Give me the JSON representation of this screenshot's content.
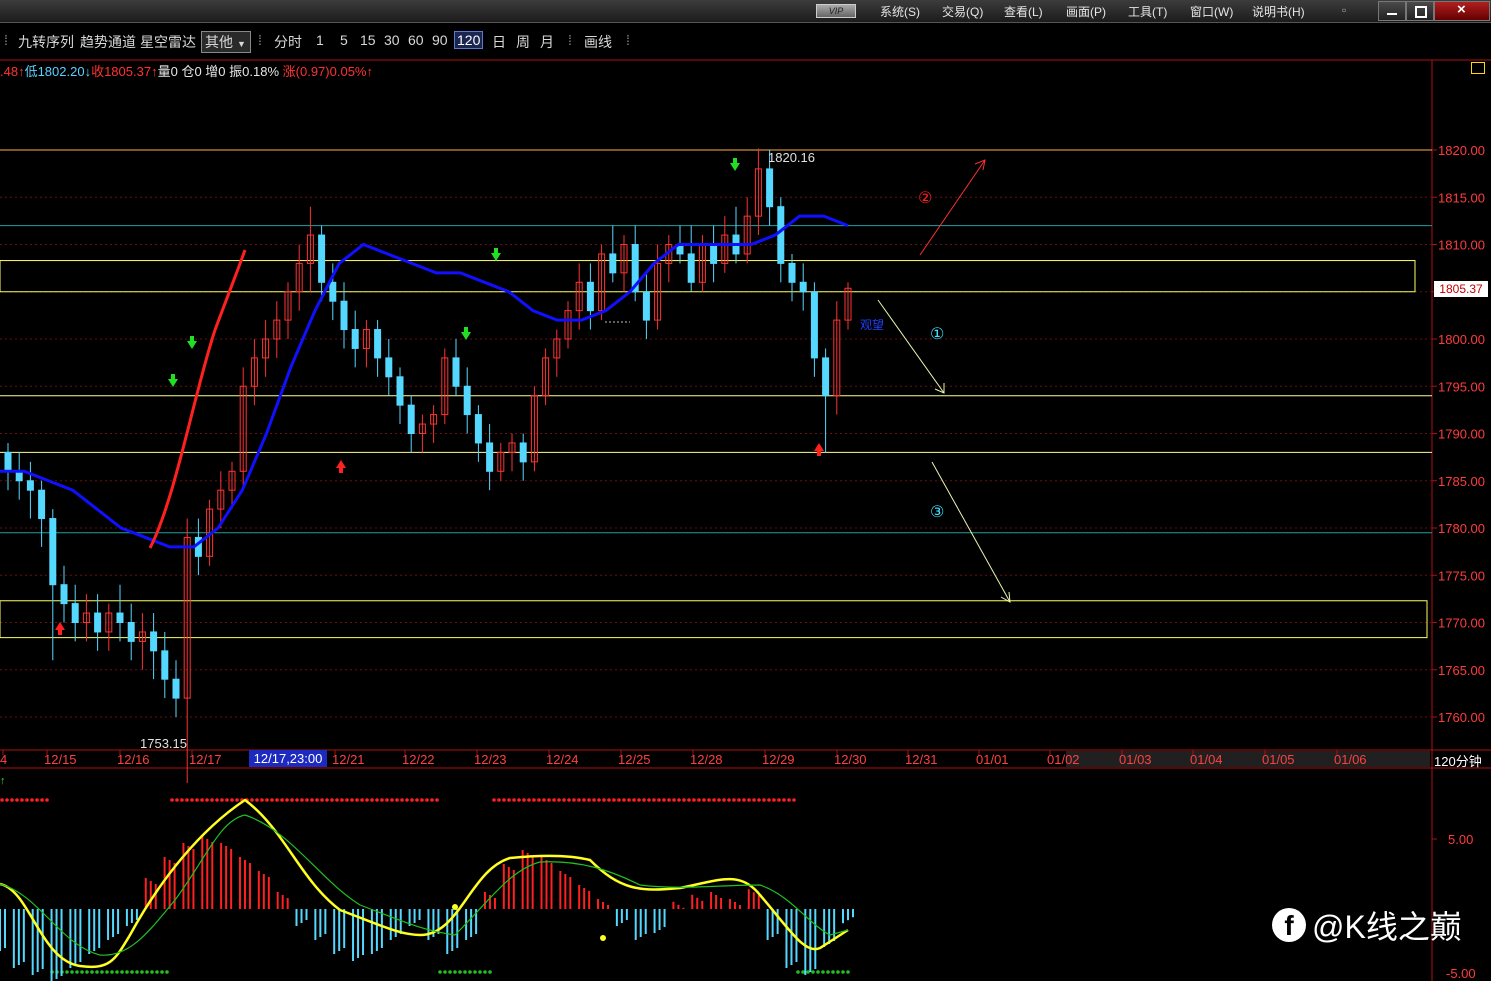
{
  "window": {
    "vip": "VIP",
    "menus": [
      "系统(S)",
      "交易(Q)",
      "查看(L)",
      "画面(P)",
      "工具(T)",
      "窗口(W)",
      "说明书(H)"
    ]
  },
  "toolbar": {
    "items": [
      "九转序列",
      "趋势通道",
      "星空雷达"
    ],
    "dropdown": "其他",
    "periods": [
      "分时",
      "1",
      "5",
      "15",
      "30",
      "60",
      "90",
      "120",
      "日",
      "周",
      "月"
    ],
    "selected_period": "120",
    "draw": "画线"
  },
  "quote": {
    "open_frag": ".48↑",
    "low": "低1802.20↓",
    "close": "收1805.37↑",
    "volume": "量0",
    "oi": "仓0",
    "incr": "增0",
    "amp": "振0.18%",
    "chg": "涨(0.97)0.05%↑"
  },
  "price_axis": {
    "ticks": [
      "1820.00",
      "1815.00",
      "1810.00",
      "1805.00",
      "1800.00",
      "1795.00",
      "1790.00",
      "1785.00",
      "1780.00",
      "1775.00",
      "1770.00",
      "1765.00",
      "1760.00"
    ],
    "last_price": "1805.37"
  },
  "time_axis": {
    "labels": [
      "4",
      "12/15",
      "12/16",
      "12/17",
      "12/21",
      "12/22",
      "12/23",
      "12/24",
      "12/25",
      "12/28",
      "12/29",
      "12/30",
      "12/31",
      "01/01",
      "01/02",
      "01/03",
      "01/04",
      "01/05",
      "01/06"
    ],
    "hover": "12/17,23:00",
    "period": "120分钟"
  },
  "annotations": {
    "high": "1820.16",
    "low": "1753.15",
    "watch": "观望",
    "path_labels": [
      "②",
      "①",
      "③"
    ]
  },
  "indicator_axis": {
    "ticks": [
      "5.00",
      "-5.00"
    ]
  },
  "watermark": {
    "icon": "f",
    "text": "@K线之巅"
  },
  "colors": {
    "up": "#ff3232",
    "down": "#54d8ff",
    "ma": "#1010ff",
    "trend": "#ff2020",
    "level": "#ffff60",
    "axis": "#b01010"
  },
  "chart_data": {
    "type": "candlestick",
    "price_ylim": [
      1757,
      1823
    ],
    "marked_high": 1820.16,
    "marked_low": 1753.15,
    "last_close": 1805.37,
    "levels": [
      1820.0,
      1812.0,
      1808.0,
      1805.0,
      1794.0,
      1788.0,
      1779.0,
      1772.0,
      1768.0
    ],
    "candles": [
      [
        1788,
        1789,
        1784,
        1786
      ],
      [
        1786,
        1788,
        1783,
        1785
      ],
      [
        1785,
        1787,
        1781,
        1784
      ],
      [
        1784,
        1785,
        1778,
        1781
      ],
      [
        1781,
        1782,
        1766,
        1774
      ],
      [
        1774,
        1776,
        1770,
        1772
      ],
      [
        1772,
        1774,
        1768,
        1770
      ],
      [
        1770,
        1773,
        1768,
        1771
      ],
      [
        1771,
        1773,
        1767,
        1769
      ],
      [
        1769,
        1772,
        1767,
        1771
      ],
      [
        1771,
        1774,
        1768,
        1770
      ],
      [
        1770,
        1772,
        1766,
        1768
      ],
      [
        1768,
        1771,
        1765,
        1769
      ],
      [
        1769,
        1771,
        1764,
        1767
      ],
      [
        1767,
        1769,
        1762,
        1764
      ],
      [
        1764,
        1766,
        1760,
        1762
      ],
      [
        1762,
        1781,
        1753,
        1779
      ],
      [
        1779,
        1781,
        1775,
        1777
      ],
      [
        1777,
        1783,
        1776,
        1782
      ],
      [
        1782,
        1786,
        1780,
        1784
      ],
      [
        1784,
        1787,
        1782,
        1786
      ],
      [
        1786,
        1797,
        1784,
        1795
      ],
      [
        1795,
        1800,
        1793,
        1798
      ],
      [
        1798,
        1802,
        1796,
        1800
      ],
      [
        1800,
        1804,
        1798,
        1802
      ],
      [
        1802,
        1806,
        1800,
        1805
      ],
      [
        1805,
        1810,
        1803,
        1808
      ],
      [
        1808,
        1814,
        1805,
        1811
      ],
      [
        1811,
        1812,
        1804,
        1806
      ],
      [
        1806,
        1808,
        1802,
        1804
      ],
      [
        1804,
        1806,
        1799,
        1801
      ],
      [
        1801,
        1803,
        1797,
        1799
      ],
      [
        1799,
        1802,
        1797,
        1801
      ],
      [
        1801,
        1802,
        1796,
        1798
      ],
      [
        1798,
        1800,
        1794,
        1796
      ],
      [
        1796,
        1797,
        1791,
        1793
      ],
      [
        1793,
        1794,
        1788,
        1790
      ],
      [
        1790,
        1792,
        1788,
        1791
      ],
      [
        1791,
        1793,
        1789,
        1792
      ],
      [
        1792,
        1799,
        1791,
        1798
      ],
      [
        1798,
        1800,
        1794,
        1795
      ],
      [
        1795,
        1797,
        1790,
        1792
      ],
      [
        1792,
        1793,
        1787,
        1789
      ],
      [
        1789,
        1791,
        1784,
        1786
      ],
      [
        1786,
        1789,
        1785,
        1788
      ],
      [
        1788,
        1790,
        1786,
        1789
      ],
      [
        1789,
        1790,
        1785,
        1787
      ],
      [
        1787,
        1795,
        1786,
        1794
      ],
      [
        1794,
        1799,
        1793,
        1798
      ],
      [
        1798,
        1801,
        1796,
        1800
      ],
      [
        1800,
        1804,
        1799,
        1803
      ],
      [
        1803,
        1808,
        1801,
        1806
      ],
      [
        1806,
        1808,
        1801,
        1803
      ],
      [
        1803,
        1810,
        1802,
        1809
      ],
      [
        1809,
        1812,
        1806,
        1807
      ],
      [
        1807,
        1811,
        1805,
        1810
      ],
      [
        1810,
        1812,
        1804,
        1805
      ],
      [
        1805,
        1807,
        1800,
        1802
      ],
      [
        1802,
        1810,
        1801,
        1808
      ],
      [
        1808,
        1811,
        1806,
        1810
      ],
      [
        1810,
        1812,
        1808,
        1809
      ],
      [
        1809,
        1812,
        1805,
        1806
      ],
      [
        1806,
        1811,
        1805,
        1810
      ],
      [
        1810,
        1812,
        1806,
        1808
      ],
      [
        1808,
        1813,
        1807,
        1811
      ],
      [
        1811,
        1814,
        1808,
        1809
      ],
      [
        1809,
        1815,
        1808,
        1813
      ],
      [
        1813,
        1820.16,
        1811,
        1818
      ],
      [
        1818,
        1820,
        1812,
        1814
      ],
      [
        1814,
        1815,
        1806,
        1808
      ],
      [
        1808,
        1809,
        1804,
        1806
      ],
      [
        1806,
        1808,
        1803,
        1805
      ],
      [
        1805,
        1806,
        1796,
        1798
      ],
      [
        1798,
        1799,
        1788,
        1794
      ],
      [
        1794,
        1804,
        1792,
        1802
      ],
      [
        1802,
        1806,
        1801,
        1805.37
      ]
    ],
    "ma": [
      1786,
      1786,
      1785,
      1784,
      1782,
      1780,
      1779,
      1778,
      1778,
      1780,
      1784,
      1790,
      1797,
      1803,
      1808,
      1810,
      1809,
      1808,
      1807,
      1807,
      1806,
      1805,
      1803,
      1802,
      1802,
      1803,
      1805,
      1808,
      1810,
      1810,
      1810,
      1810,
      1811,
      1813,
      1813,
      1812
    ],
    "macd_hist": [
      -3,
      -4,
      -4.5,
      -5,
      -4,
      -3,
      -2,
      -1,
      2,
      3.5,
      4.5,
      5,
      4.5,
      3.5,
      2.5,
      1,
      -1,
      -2,
      -3,
      -3.5,
      -3,
      -2,
      -1,
      -2,
      -3,
      -2,
      1,
      3,
      4,
      3.5,
      2.5,
      1.5,
      0.5,
      -1,
      -2,
      -1.5,
      0.3,
      0.8,
      1,
      0.5,
      1.2,
      -2,
      -4,
      -4.5,
      -2.5,
      -0.8
    ],
    "ylim_macd": [
      -5.8,
      7.5
    ]
  }
}
